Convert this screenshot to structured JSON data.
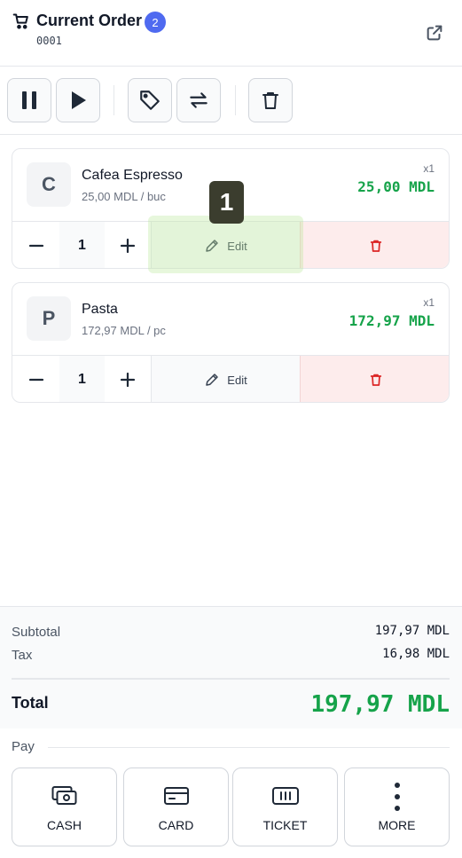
{
  "header": {
    "title": "Current Order",
    "badge_count": "2",
    "order_number": "0001",
    "icons": {
      "cart": "cart-icon",
      "open_external": "external-link-icon"
    }
  },
  "toolbar": {
    "buttons": [
      {
        "name": "pause",
        "icon": "pause-icon"
      },
      {
        "name": "resume",
        "icon": "play-icon"
      },
      {
        "name": "discount",
        "icon": "tag-icon"
      },
      {
        "name": "transfer",
        "icon": "repeat-icon"
      },
      {
        "name": "clear",
        "icon": "trash-icon"
      }
    ]
  },
  "items": [
    {
      "initial": "C",
      "name": "Cafea Espresso",
      "unit_price": "25,00 MDL / buc",
      "quantity_badge": "x1",
      "line_total": "25,00 MDL",
      "quantity": "1",
      "edit_label": "Edit"
    },
    {
      "initial": "P",
      "name": "Pasta",
      "unit_price": "172,97 MDL / pc",
      "quantity_badge": "x1",
      "line_total": "172,97 MDL",
      "quantity": "1",
      "edit_label": "Edit"
    }
  ],
  "annotation": {
    "marker": "1"
  },
  "totals": {
    "subtotal_label": "Subtotal",
    "subtotal_value": "197,97 MDL",
    "tax_label": "Tax",
    "tax_value": "16,98 MDL",
    "total_label": "Total",
    "total_value": "197,97 MDL"
  },
  "pay": {
    "label": "Pay",
    "methods": [
      {
        "label": "CASH",
        "icon": "cash-icon"
      },
      {
        "label": "CARD",
        "icon": "card-icon"
      },
      {
        "label": "TICKET",
        "icon": "ticket-icon"
      },
      {
        "label": "MORE",
        "icon": "more-vertical-icon"
      }
    ]
  },
  "colors": {
    "accent": "#4f6af0",
    "price_green": "#16a34a",
    "danger": "#dc2626",
    "danger_bg": "#fdecec"
  }
}
